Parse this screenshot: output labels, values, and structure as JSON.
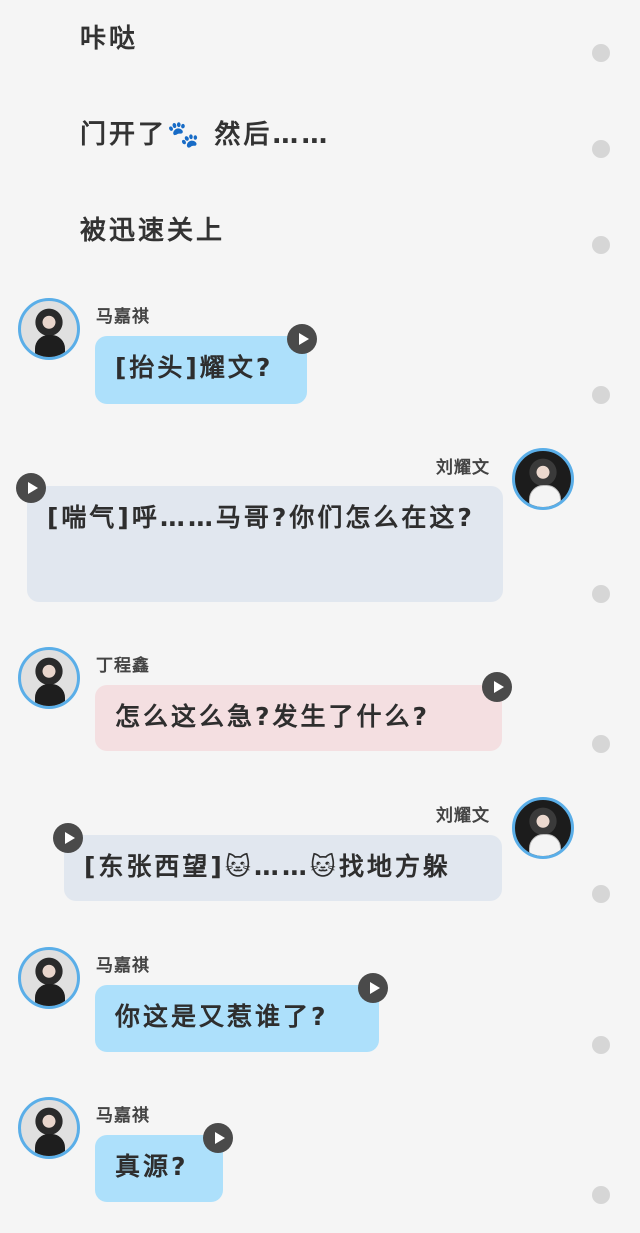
{
  "narration": [
    {
      "text": "咔哒"
    },
    {
      "text": "门开了🐾 然后……"
    },
    {
      "text": "被迅速关上"
    }
  ],
  "messages": [
    {
      "speaker": "马嘉祺",
      "text": "[抬头]耀文?"
    },
    {
      "speaker": "刘耀文",
      "text": "[喘气]呼……马哥?你们怎么在这?"
    },
    {
      "speaker": "丁程鑫",
      "text": "怎么这么急?发生了什么?"
    },
    {
      "speaker": "刘耀文",
      "text": "[东张西望]🐱……🐱找地方躲"
    },
    {
      "speaker": "马嘉祺",
      "text": "你这是又惹谁了?"
    },
    {
      "speaker": "马嘉祺",
      "text": "真源?"
    }
  ],
  "icons": {
    "play": "play-icon",
    "status": "status-dot-icon"
  },
  "colors": {
    "blue_bubble": "#ade0fb",
    "gray_bubble": "#e1e7ef",
    "pink_bubble": "#f4dfe1",
    "avatar_border": "#5aaee8",
    "play_button": "#4a4a4a"
  }
}
